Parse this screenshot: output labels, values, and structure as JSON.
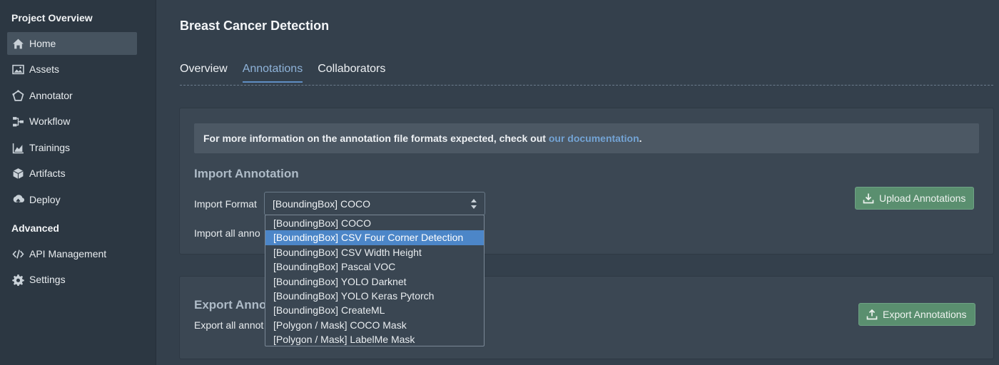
{
  "sidebar": {
    "project_section": "Project Overview",
    "advanced_section": "Advanced",
    "items": [
      {
        "label": "Home",
        "icon": "home-icon",
        "active": true
      },
      {
        "label": "Assets",
        "icon": "image-icon"
      },
      {
        "label": "Annotator",
        "icon": "pentagon-icon"
      },
      {
        "label": "Workflow",
        "icon": "workflow-icon"
      },
      {
        "label": "Trainings",
        "icon": "chart-icon"
      },
      {
        "label": "Artifacts",
        "icon": "cube-icon"
      },
      {
        "label": "Deploy",
        "icon": "deploy-icon"
      }
    ],
    "advanced_items": [
      {
        "label": "API Management",
        "icon": "code-icon"
      },
      {
        "label": "Settings",
        "icon": "gear-icon"
      }
    ]
  },
  "page": {
    "title": "Breast Cancer Detection",
    "tabs": [
      {
        "label": "Overview"
      },
      {
        "label": "Annotations",
        "active": true
      },
      {
        "label": "Collaborators"
      }
    ]
  },
  "import": {
    "info_text": "For more information on the annotation file formats expected, check out ",
    "info_link": "our documentation",
    "info_end": ".",
    "heading": "Import Annotation",
    "format_label": "Import Format",
    "format_value": "[BoundingBox] COCO",
    "all_label": "Import all anno",
    "upload_button": "Upload Annotations"
  },
  "export": {
    "heading": "Export Anno",
    "all_label": "Export all annot",
    "export_button": "Export Annotations"
  },
  "dropdown": {
    "options": [
      "[BoundingBox] COCO",
      "[BoundingBox] CSV Four Corner Detection",
      "[BoundingBox] CSV Width Height",
      "[BoundingBox] Pascal VOC",
      "[BoundingBox] YOLO Darknet",
      "[BoundingBox] YOLO Keras Pytorch",
      "[BoundingBox] CreateML",
      "[Polygon / Mask] COCO Mask",
      "[Polygon / Mask] LabelMe Mask"
    ],
    "highlighted_index": 1
  },
  "colors": {
    "accent": "#5f8ec4",
    "link": "#73a3d4",
    "button_green": "#5a8f6f",
    "highlight": "#4c86c8"
  }
}
